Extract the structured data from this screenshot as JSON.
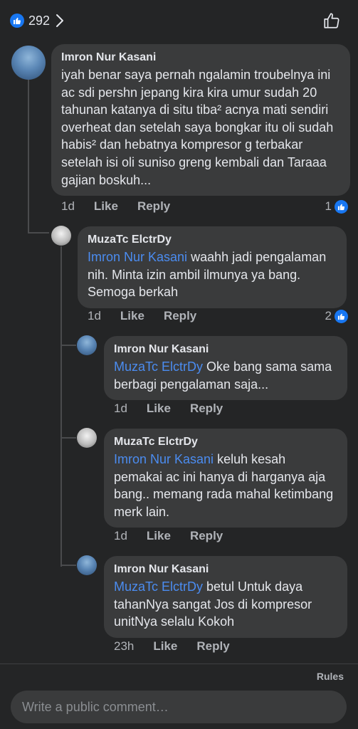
{
  "header": {
    "reaction_count": "292",
    "like_icon": "thumbs-up-icon",
    "colors": {
      "like_blue": "#1877f2"
    }
  },
  "comments": [
    {
      "author": "Imron Nur Kasani",
      "text": "iyah benar saya pernah ngalamin troubelnya ini ac sdi pershn jepang kira kira umur sudah 20 tahunan katanya di situ tiba² acnya mati sendiri overheat dan setelah saya bongkar itu oli sudah habis² dan hebatnya kompresor g terbakar setelah isi oli suniso greng kembali dan Taraaa gajian boskuh...",
      "time": "1d",
      "like_label": "Like",
      "reply_label": "Reply",
      "reactions": "1"
    },
    {
      "author": "MuzaTc ElctrDy",
      "mention": "Imron Nur Kasani",
      "text": " waahh jadi pengalaman nih.  Minta izin ambil ilmunya ya bang.  Semoga berkah",
      "time": "1d",
      "like_label": "Like",
      "reply_label": "Reply",
      "reactions": "2"
    },
    {
      "author": "Imron Nur Kasani",
      "mention": "MuzaTc ElctrDy",
      "text": " Oke bang sama sama berbagi pengalaman saja...",
      "time": "1d",
      "like_label": "Like",
      "reply_label": "Reply"
    },
    {
      "author": "MuzaTc ElctrDy",
      "mention": "Imron Nur Kasani",
      "text": "  keluh kesah pemakai ac ini hanya di harganya aja bang.. memang rada mahal ketimbang merk lain.",
      "time": "1d",
      "like_label": "Like",
      "reply_label": "Reply"
    },
    {
      "author": "Imron Nur Kasani",
      "mention": "MuzaTc ElctrDy",
      "text": " betul Untuk daya tahanNya sangat Jos di kompresor unitNya selalu Kokoh",
      "time": "23h",
      "like_label": "Like",
      "reply_label": "Reply"
    }
  ],
  "footer": {
    "rules_label": "Rules",
    "comment_placeholder": "Write a public comment…"
  }
}
